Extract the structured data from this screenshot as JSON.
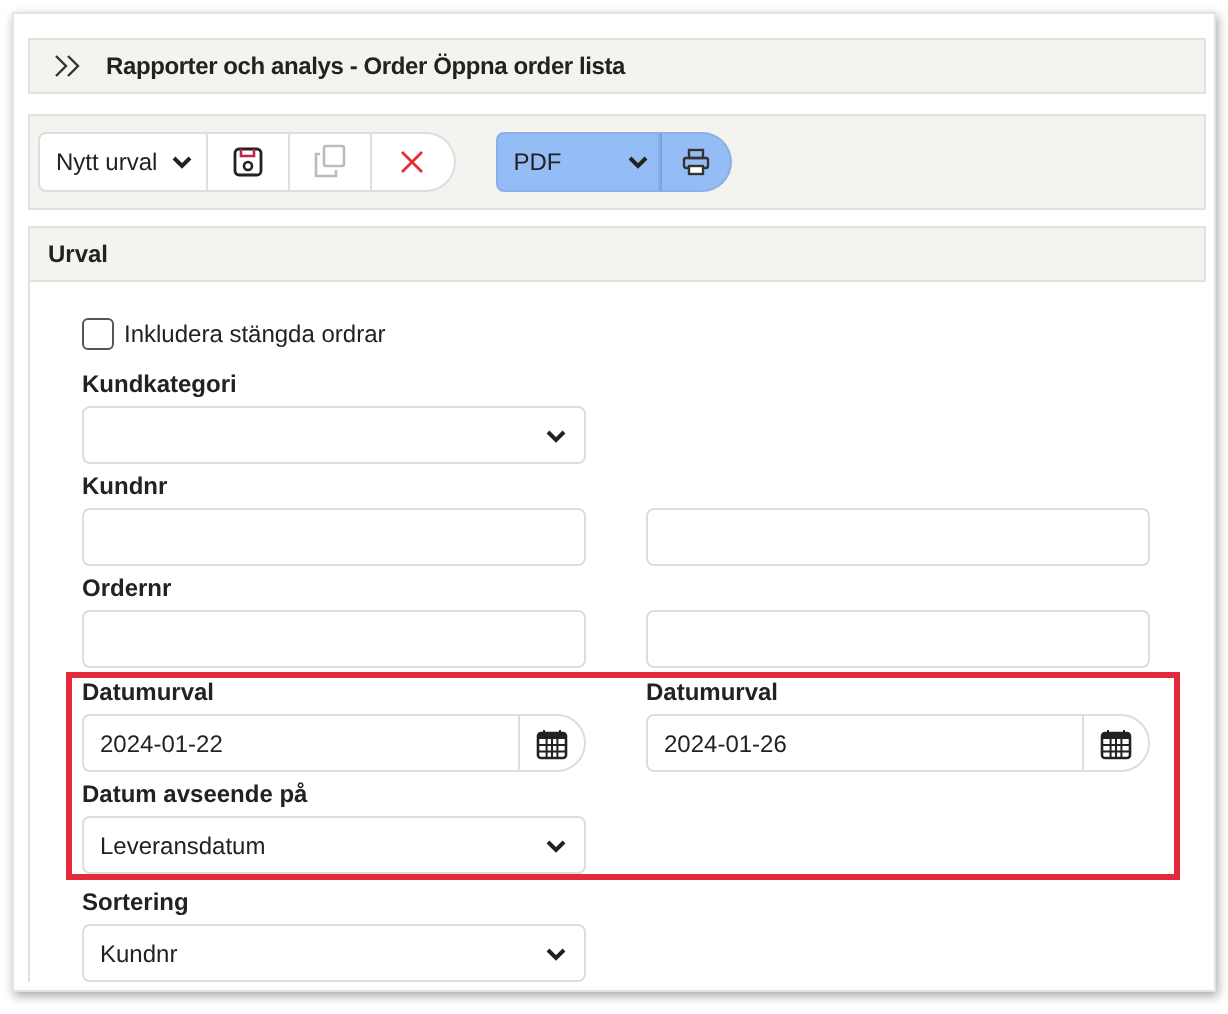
{
  "header": {
    "title": "Rapporter och analys - Order Öppna order lista"
  },
  "toolbar": {
    "selection": {
      "value": "Nytt urval"
    },
    "buttons": [
      {
        "kind": "save",
        "disabled": false
      },
      {
        "kind": "copy",
        "disabled": true
      },
      {
        "kind": "delete",
        "disabled": false
      }
    ],
    "format": {
      "value": "PDF"
    }
  },
  "section": {
    "title": "Urval",
    "checkbox": {
      "label": "Inkludera stängda ordrar",
      "checked": false
    },
    "rows": [
      {
        "kind": "row",
        "cells": [
          {
            "label": "Kundkategori",
            "kind": "select"
          }
        ]
      },
      {
        "kind": "row",
        "cells": [
          {
            "label": "Kundnr",
            "kind": "text"
          },
          {
            "kind": "text"
          }
        ]
      },
      {
        "kind": "row",
        "cells": [
          {
            "label": "Ordernr",
            "kind": "text"
          },
          {
            "kind": "text"
          }
        ]
      },
      {
        "kind": "highlight",
        "rows": [
          {
            "kind": "row",
            "cells": [
              {
                "label": "Datumurval",
                "kind": "date",
                "value": "2024-01-22"
              },
              {
                "label": "Datumurval",
                "kind": "date",
                "value": "2024-01-26"
              }
            ]
          },
          {
            "kind": "row",
            "cells": [
              {
                "label": "Datum avseende på",
                "kind": "select",
                "value": "Leveransdatum"
              }
            ]
          }
        ]
      },
      {
        "kind": "row",
        "cells": [
          {
            "label": "Sortering",
            "kind": "select",
            "value": "Kundnr"
          }
        ]
      }
    ]
  }
}
